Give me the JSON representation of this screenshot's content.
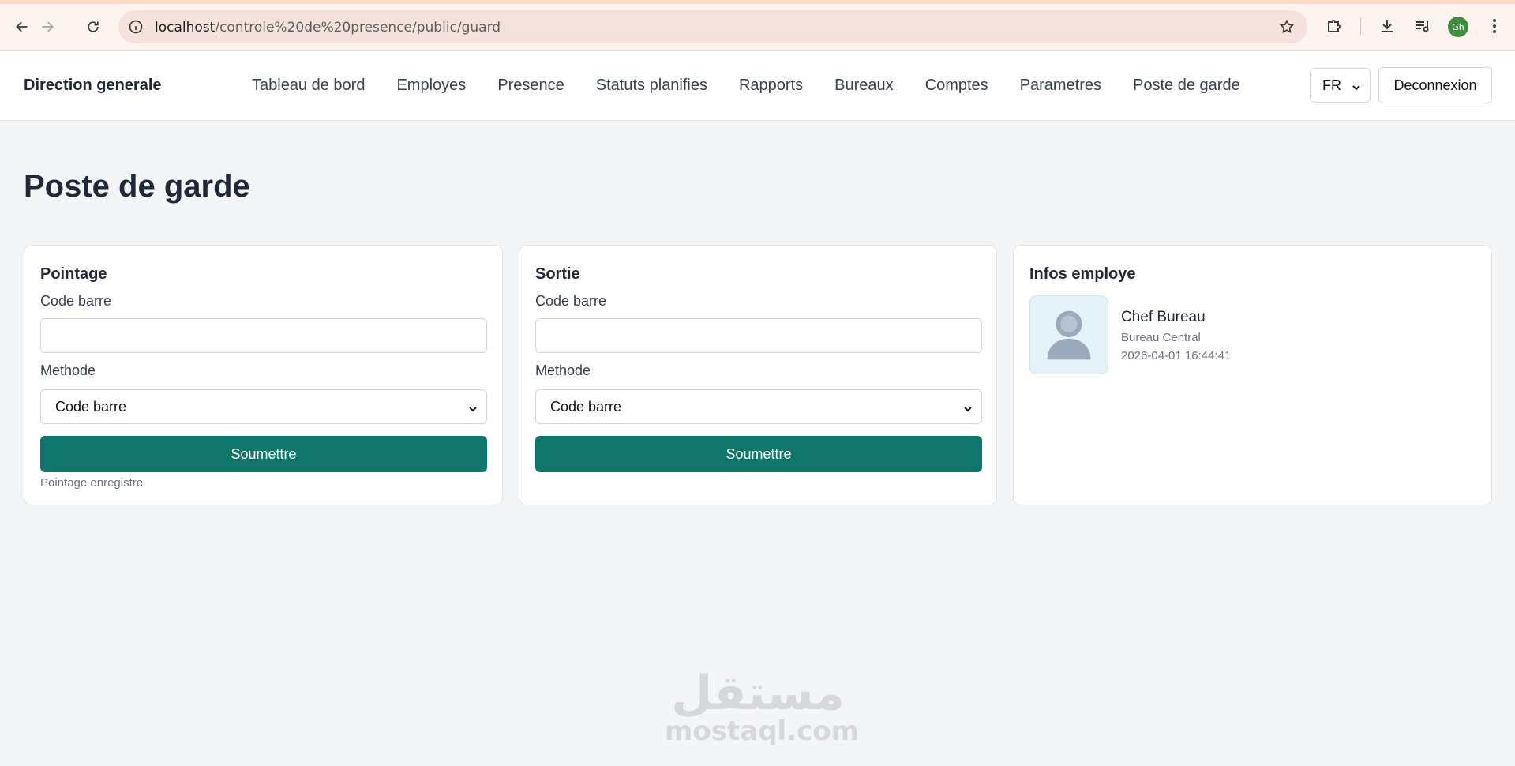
{
  "browser": {
    "url_host": "localhost",
    "url_path": "/controle%20de%20presence/public/guard",
    "profile_initials": "Gh",
    "icons": [
      "back-icon",
      "forward-icon",
      "reload-icon",
      "site-info-icon",
      "bookmark-star-icon",
      "extensions-icon",
      "download-icon",
      "media-control-icon",
      "menu-icon"
    ]
  },
  "header": {
    "brand": "Direction generale",
    "nav": [
      "Tableau de bord",
      "Employes",
      "Presence",
      "Statuts planifies",
      "Rapports",
      "Bureaux",
      "Comptes",
      "Parametres",
      "Poste de garde"
    ],
    "language": "FR",
    "logout_label": "Deconnexion"
  },
  "page": {
    "title": "Poste de garde"
  },
  "checkin_card": {
    "title": "Pointage",
    "barcode_label": "Code barre",
    "barcode_value": "",
    "method_label": "Methode",
    "method_value": "Code barre",
    "submit_label": "Soumettre",
    "status": "Pointage enregistre"
  },
  "checkout_card": {
    "title": "Sortie",
    "barcode_label": "Code barre",
    "barcode_value": "",
    "method_label": "Methode",
    "method_value": "Code barre",
    "submit_label": "Soumettre"
  },
  "employee_card": {
    "title": "Infos employe",
    "name": "Chef Bureau",
    "office": "Bureau Central",
    "timestamp": "2026-04-01 16:44:41"
  },
  "watermark": {
    "arabic": "مستقل",
    "latin": "mostaql.com"
  },
  "colors": {
    "accent": "#10766b",
    "page_background": "#f4f5f7",
    "browser_bar": "#fdf3ef",
    "profile": "#3e8e3e"
  }
}
